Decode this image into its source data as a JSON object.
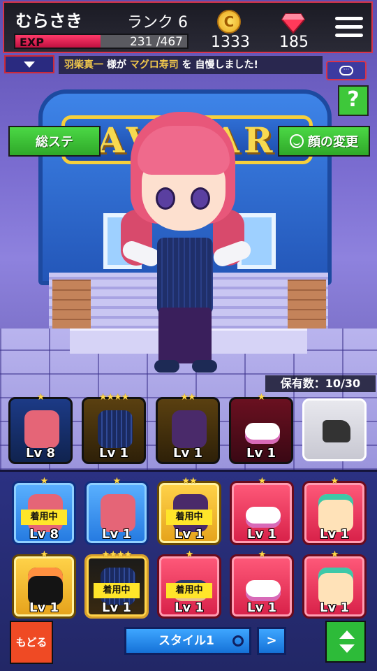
{
  "header": {
    "player_name": "むらさき",
    "rank": "ランク 6",
    "exp_label": "EXP",
    "exp_value": "231 /467",
    "exp_progress": 0.4946,
    "coins": "1333",
    "gems": "185",
    "coin_symbol": "C"
  },
  "notice": {
    "player": "羽柴真一",
    "text1": " 様が ",
    "item": "マグロ寿司",
    "text2": " を 自慢しました!"
  },
  "scene": {
    "building_sign": "AVATAR"
  },
  "buttons": {
    "total_stats": "総ステ",
    "face_change": "顔の変更",
    "help": "?",
    "back": "もどる",
    "style": "スタイル1",
    "next_style": ">"
  },
  "owned_count": "保有数：10/30",
  "equipped": [
    {
      "level": "Lv 8",
      "stars": "★",
      "kind": "hair",
      "frame": "blue"
    },
    {
      "level": "Lv 1",
      "stars": "★★★★",
      "kind": "suit",
      "frame": "gold"
    },
    {
      "level": "Lv 1",
      "stars": "★★",
      "kind": "pants",
      "frame": "gold"
    },
    {
      "level": "Lv 1",
      "stars": "★",
      "kind": "shoes",
      "frame": "red"
    }
  ],
  "inventory": [
    {
      "level": "Lv 8",
      "stars": "★",
      "kind": "hair",
      "frame": "blue",
      "tag": "着用中"
    },
    {
      "level": "Lv 1",
      "stars": "★",
      "kind": "hair",
      "frame": "blue",
      "tag": ""
    },
    {
      "level": "Lv 1",
      "stars": "★★",
      "kind": "pants",
      "frame": "gold",
      "tag": "着用中"
    },
    {
      "level": "Lv 1",
      "stars": "★",
      "kind": "shoes",
      "frame": "red",
      "tag": ""
    },
    {
      "level": "Lv 1",
      "stars": "★",
      "kind": "glove",
      "frame": "red",
      "tag": ""
    },
    {
      "level": "Lv 1",
      "stars": "★",
      "kind": "sushi",
      "frame": "gold",
      "tag": ""
    },
    {
      "level": "Lv 1",
      "stars": "★★★★",
      "kind": "suit",
      "frame": "goldblack",
      "tag": "着用中"
    },
    {
      "level": "Lv 1",
      "stars": "★",
      "kind": "shoes-dark",
      "frame": "red",
      "tag": "着用中"
    },
    {
      "level": "Lv 1",
      "stars": "★",
      "kind": "shoes",
      "frame": "red",
      "tag": ""
    },
    {
      "level": "Lv 1",
      "stars": "★",
      "kind": "glove",
      "frame": "red",
      "tag": ""
    }
  ],
  "colors": {
    "accent_green": "#3ec83a",
    "exp_bar": "#e8305a",
    "header_border": "#d8344a",
    "inventory_bg": "#2b3182"
  }
}
